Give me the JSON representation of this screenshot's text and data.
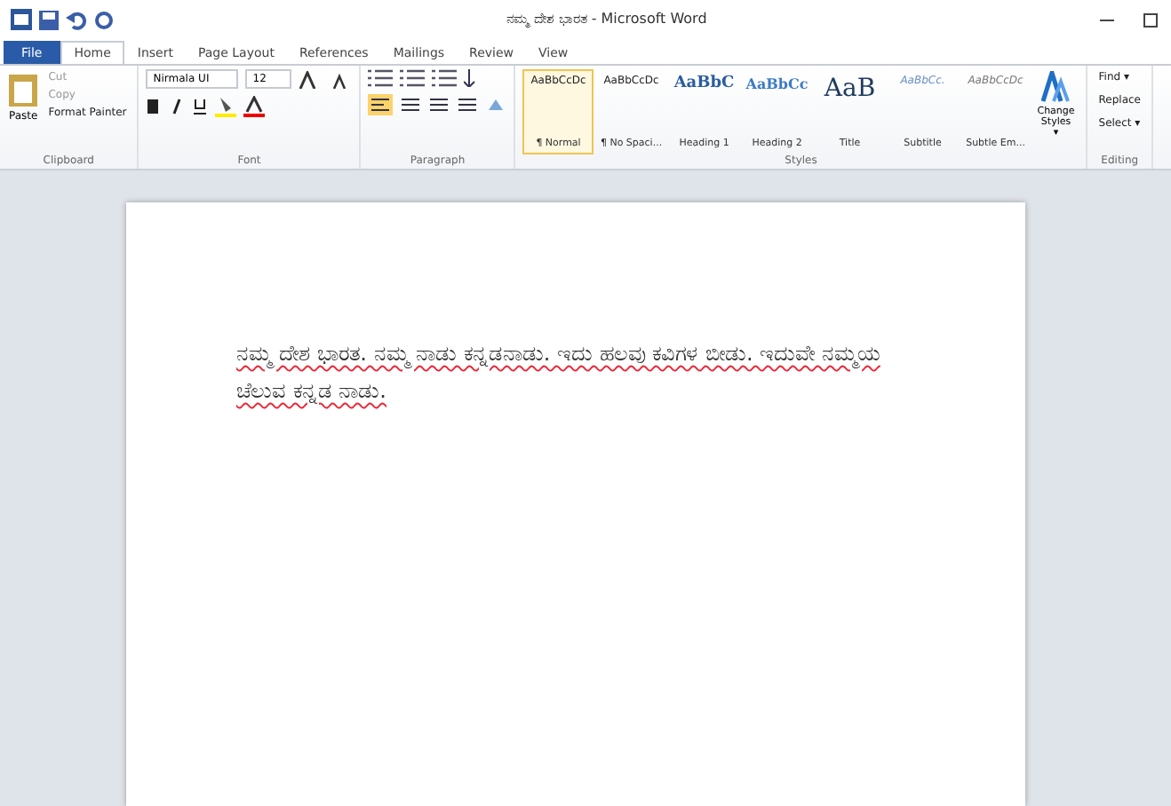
{
  "window": {
    "title": "ನಮ್ಮ ದೇಶ ಭಾರತ - Microsoft Word"
  },
  "tabs": [
    {
      "label": "File",
      "kind": "file",
      "selected": false
    },
    {
      "label": "Home",
      "kind": "tab",
      "selected": true
    },
    {
      "label": "Insert",
      "kind": "tab",
      "selected": false
    },
    {
      "label": "Page Layout",
      "kind": "tab",
      "selected": false
    },
    {
      "label": "References",
      "kind": "tab",
      "selected": false
    },
    {
      "label": "Mailings",
      "kind": "tab",
      "selected": false
    },
    {
      "label": "Review",
      "kind": "tab",
      "selected": false
    },
    {
      "label": "View",
      "kind": "tab",
      "selected": false
    }
  ],
  "clipboard": {
    "paste": "Paste",
    "cut": "Cut",
    "copy": "Copy",
    "format_painter": "Format Painter",
    "label": "Clipboard"
  },
  "font": {
    "name": "Nirmala UI",
    "size": "12",
    "label": "Font"
  },
  "paragraph": {
    "label": "Paragraph"
  },
  "styles": {
    "items": [
      {
        "preview": "AaBbCcDc",
        "name": "¶ Normal",
        "kind": "normal",
        "selected": true
      },
      {
        "preview": "AaBbCcDc",
        "name": "¶ No Spaci...",
        "kind": "normal",
        "selected": false
      },
      {
        "preview": "AaBbC",
        "name": "Heading 1",
        "kind": "heading1",
        "selected": false
      },
      {
        "preview": "AaBbCc",
        "name": "Heading 2",
        "kind": "heading2",
        "selected": false
      },
      {
        "preview": "AaB",
        "name": "Title",
        "kind": "title",
        "selected": false
      },
      {
        "preview": "AaBbCc.",
        "name": "Subtitle",
        "kind": "subtitle",
        "selected": false
      },
      {
        "preview": "AaBbCcDc",
        "name": "Subtle Em...",
        "kind": "subtle",
        "selected": false
      }
    ],
    "change_styles": "Change Styles ▾",
    "label": "Styles"
  },
  "editing": {
    "find": "Find ▾",
    "replace": "Replace",
    "select": "Select ▾",
    "label": "Editing"
  },
  "document": {
    "paragraph": "ನಮ್ಮ ದೇಶ ಭಾರತ. ನಮ್ಮ ನಾಡು ಕನ್ನಡನಾಡು. ಇದು ಹಲವು ಕವಿಗಳ ಬೀಡು. ಇದುವೇ ನಮ್ಮಯ ಚೆಲುವ ಕನ್ನಡ ನಾಡು.",
    "spell_errors": true
  }
}
